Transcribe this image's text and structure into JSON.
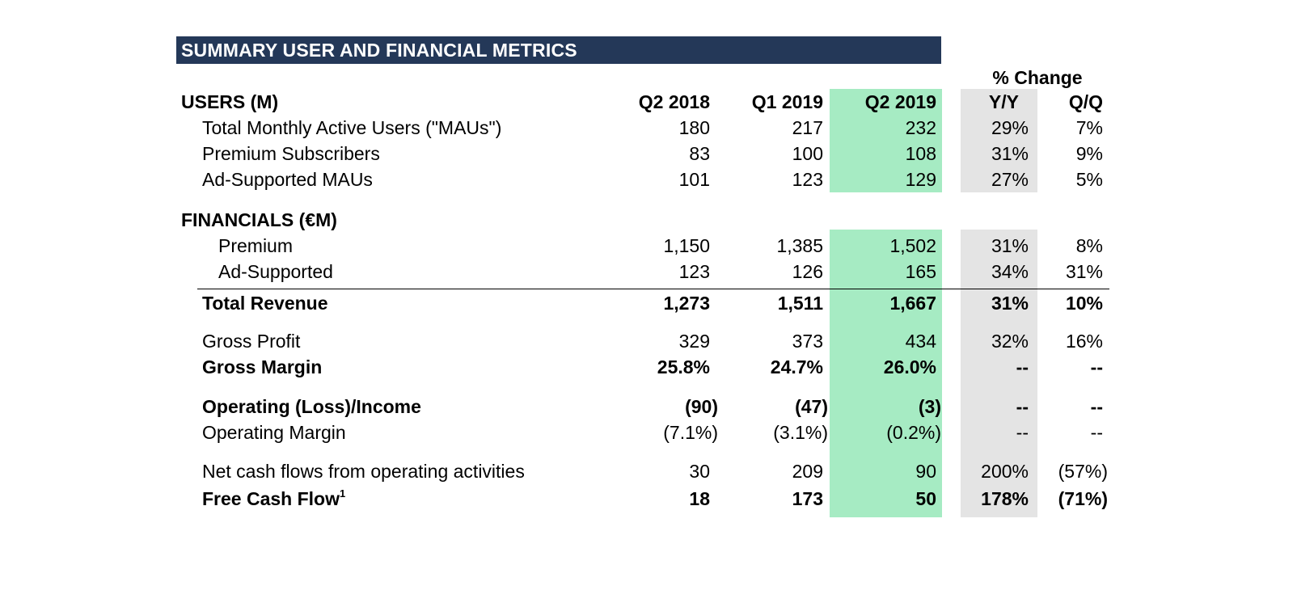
{
  "title": "SUMMARY USER AND FINANCIAL METRICS",
  "change_header": "% Change",
  "columns": [
    "Q2 2018",
    "Q1 2019",
    "Q2 2019",
    "Y/Y",
    "Q/Q"
  ],
  "colors": {
    "title_bg": "#243858",
    "current_quarter_highlight": "#a6ebc3",
    "yy_highlight": "#e4e4e4"
  },
  "users": {
    "section": "USERS (M)",
    "rows": [
      {
        "label": "Total Monthly Active Users (\"MAUs\")",
        "v": [
          "180",
          "217",
          "232",
          "29%",
          "7%"
        ]
      },
      {
        "label": "Premium Subscribers",
        "v": [
          "83",
          "100",
          "108",
          "31%",
          "9%"
        ]
      },
      {
        "label": "Ad-Supported MAUs",
        "v": [
          "101",
          "123",
          "129",
          "27%",
          "5%"
        ]
      }
    ]
  },
  "financials": {
    "section": "FINANCIALS (€M)",
    "premium": {
      "label": "Premium",
      "v": [
        "1,150",
        "1,385",
        "1,502",
        "31%",
        "8%"
      ]
    },
    "ad_supported": {
      "label": "Ad-Supported",
      "v": [
        "123",
        "126",
        "165",
        "34%",
        "31%"
      ]
    },
    "total_revenue": {
      "label": "Total Revenue",
      "v": [
        "1,273",
        "1,511",
        "1,667",
        "31%",
        "10%"
      ]
    },
    "gross_profit": {
      "label": "Gross Profit",
      "v": [
        "329",
        "373",
        "434",
        "32%",
        "16%"
      ]
    },
    "gross_margin": {
      "label": "Gross Margin",
      "v": [
        "25.8%",
        "24.7%",
        "26.0%",
        "--",
        "--"
      ]
    },
    "operating_income": {
      "label": "Operating (Loss)/Income",
      "v": [
        "(90)",
        "(47)",
        "(3)",
        "--",
        "--"
      ]
    },
    "operating_margin": {
      "label": "Operating Margin",
      "v": [
        "(7.1%)",
        "(3.1%)",
        "(0.2%)",
        "--",
        "--"
      ]
    },
    "net_cash": {
      "label": "Net cash flows from operating activities",
      "v": [
        "30",
        "209",
        "90",
        "200%",
        "(57%)"
      ]
    },
    "fcf": {
      "label": "Free Cash Flow",
      "footnote": "1",
      "v": [
        "18",
        "173",
        "50",
        "178%",
        "(71%)"
      ]
    }
  }
}
